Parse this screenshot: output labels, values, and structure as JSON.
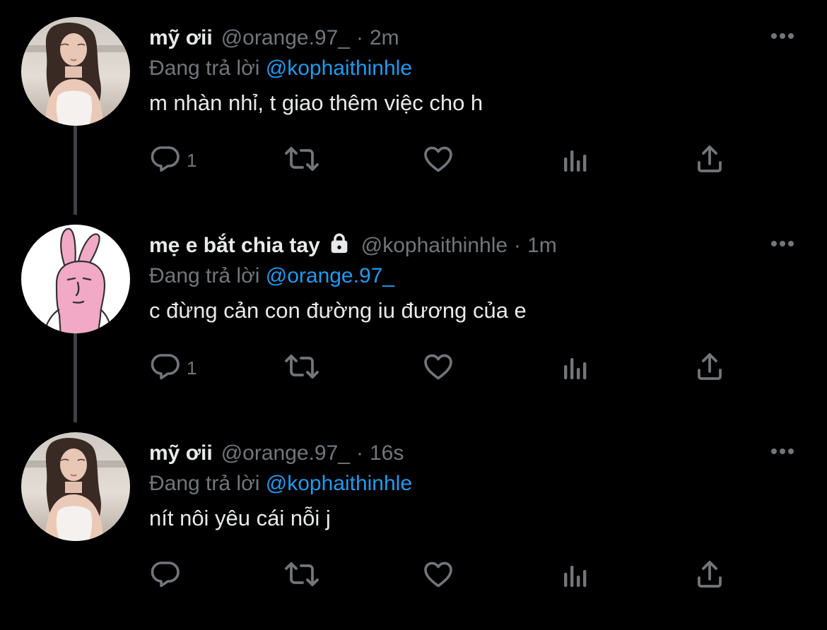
{
  "colors": {
    "background": "#000000",
    "text": "#e7e9ea",
    "secondary": "#71767b",
    "link": "#1d9bf0",
    "thread_line": "#3e4144"
  },
  "tweets": [
    {
      "display_name": "mỹ ơii",
      "handle": "@orange.97_",
      "separator": "·",
      "time": "2m",
      "replying_prefix": "Đang trả lời",
      "replying_to": "@kophaithinhle",
      "text": "m nhàn nhỉ, t giao thêm việc cho h",
      "reply_count": "1",
      "locked": false,
      "avatar": "woman-photo"
    },
    {
      "display_name": "mẹ e bắt chia tay",
      "handle": "@kophaithinhle",
      "separator": "·",
      "time": "1m",
      "replying_prefix": "Đang trả lời",
      "replying_to": "@orange.97_",
      "text": "c đừng cản con đường iu đương của e",
      "reply_count": "1",
      "locked": true,
      "avatar": "pink-rabbit"
    },
    {
      "display_name": "mỹ ơii",
      "handle": "@orange.97_",
      "separator": "·",
      "time": "16s",
      "replying_prefix": "Đang trả lời",
      "replying_to": "@kophaithinhle",
      "text": "nít nôi yêu cái nỗi j",
      "reply_count": "",
      "locked": false,
      "avatar": "woman-photo"
    }
  ],
  "icons": {
    "reply": "reply-bubble-icon",
    "retweet": "retweet-icon",
    "like": "heart-icon",
    "views": "analytics-icon",
    "share": "share-icon",
    "more": "more-dots-icon",
    "lock": "lock-icon"
  }
}
